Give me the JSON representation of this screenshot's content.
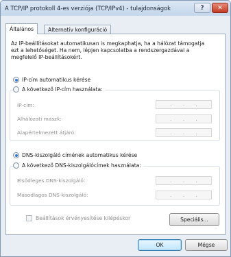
{
  "window": {
    "title": "A TCP/IP protokoll 4-es verziója (TCP/IPv4) - tulajdonságok",
    "help_label": "?",
    "close_label": "✕"
  },
  "tabs": [
    {
      "label": "Általános",
      "active": true
    },
    {
      "label": "Alternatív konfiguráció",
      "active": false
    }
  ],
  "description": "Az IP-beállításokat automatikusan is megkaphatja, ha a hálózat támogatja ezt a lehetőséget. Ha nem, lépjen kapcsolatba a rendszergazdával a megfelelő IP-beállításokért.",
  "ip": {
    "auto_label": "IP-cím automatikus kérése",
    "manual_label": "A következő IP-cím használata:",
    "fields": [
      {
        "label": "IP-cím:"
      },
      {
        "label": "Alhálózati maszk:"
      },
      {
        "label": "Alapértelmezett átjáró:"
      }
    ]
  },
  "dns": {
    "auto_label": "DNS-kiszolgáló címének automatikus kérése",
    "manual_label": "A következő DNS-kiszolgálócímek használata:",
    "fields": [
      {
        "label": "Elsődleges DNS-kiszolgáló:"
      },
      {
        "label": "Másodlagos DNS-kiszolgáló:"
      }
    ]
  },
  "validate_label": "Beállítások érvényesítése kilépéskor",
  "buttons": {
    "advanced": "Speciális...",
    "ok": "OK",
    "cancel": "Mégse"
  },
  "ip_separator": "."
}
